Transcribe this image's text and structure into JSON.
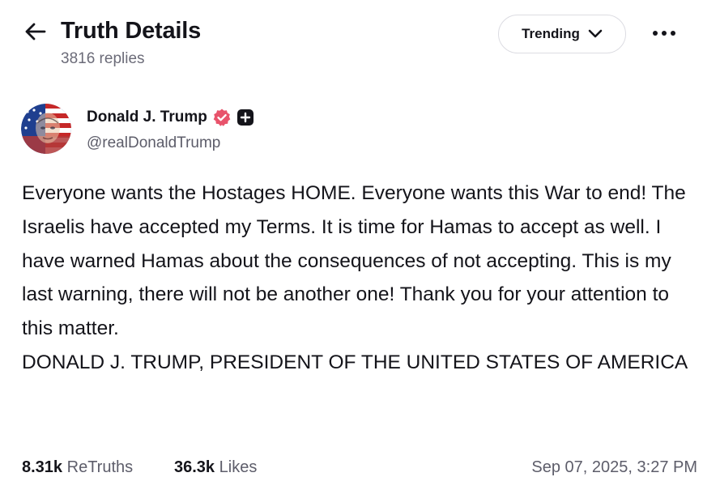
{
  "header": {
    "title": "Truth Details",
    "replies": "3816 replies",
    "sort_label": "Trending"
  },
  "author": {
    "name": "Donald J. Trump",
    "handle": "@realDonaldTrump"
  },
  "post": {
    "paragraphs": [
      "Everyone wants the Hostages HOME. Everyone wants this War to end! The Israelis have accepted my Terms. It is time for Hamas to accept as well. I have warned Hamas about the consequences of not accepting. This is my last warning, there will not be another one! Thank you for your attention to this matter.",
      "DONALD J. TRUMP, PRESIDENT OF THE UNITED STATES OF AMERICA"
    ]
  },
  "stats": {
    "retruths_count": "8.31k",
    "retruths_label": "ReTruths",
    "likes_count": "36.3k",
    "likes_label": "Likes",
    "timestamp": "Sep 07, 2025, 3:27 PM"
  },
  "colors": {
    "verified_badge": "#e8536b",
    "muted_text": "#5d5d6a",
    "border": "#dcdce2"
  },
  "icons": {
    "back": "arrow-left-icon",
    "dropdown": "chevron-down-icon",
    "more": "more-horizontal-icon",
    "verified": "verified-badge-icon",
    "plus_badge": "plus-badge-icon"
  }
}
